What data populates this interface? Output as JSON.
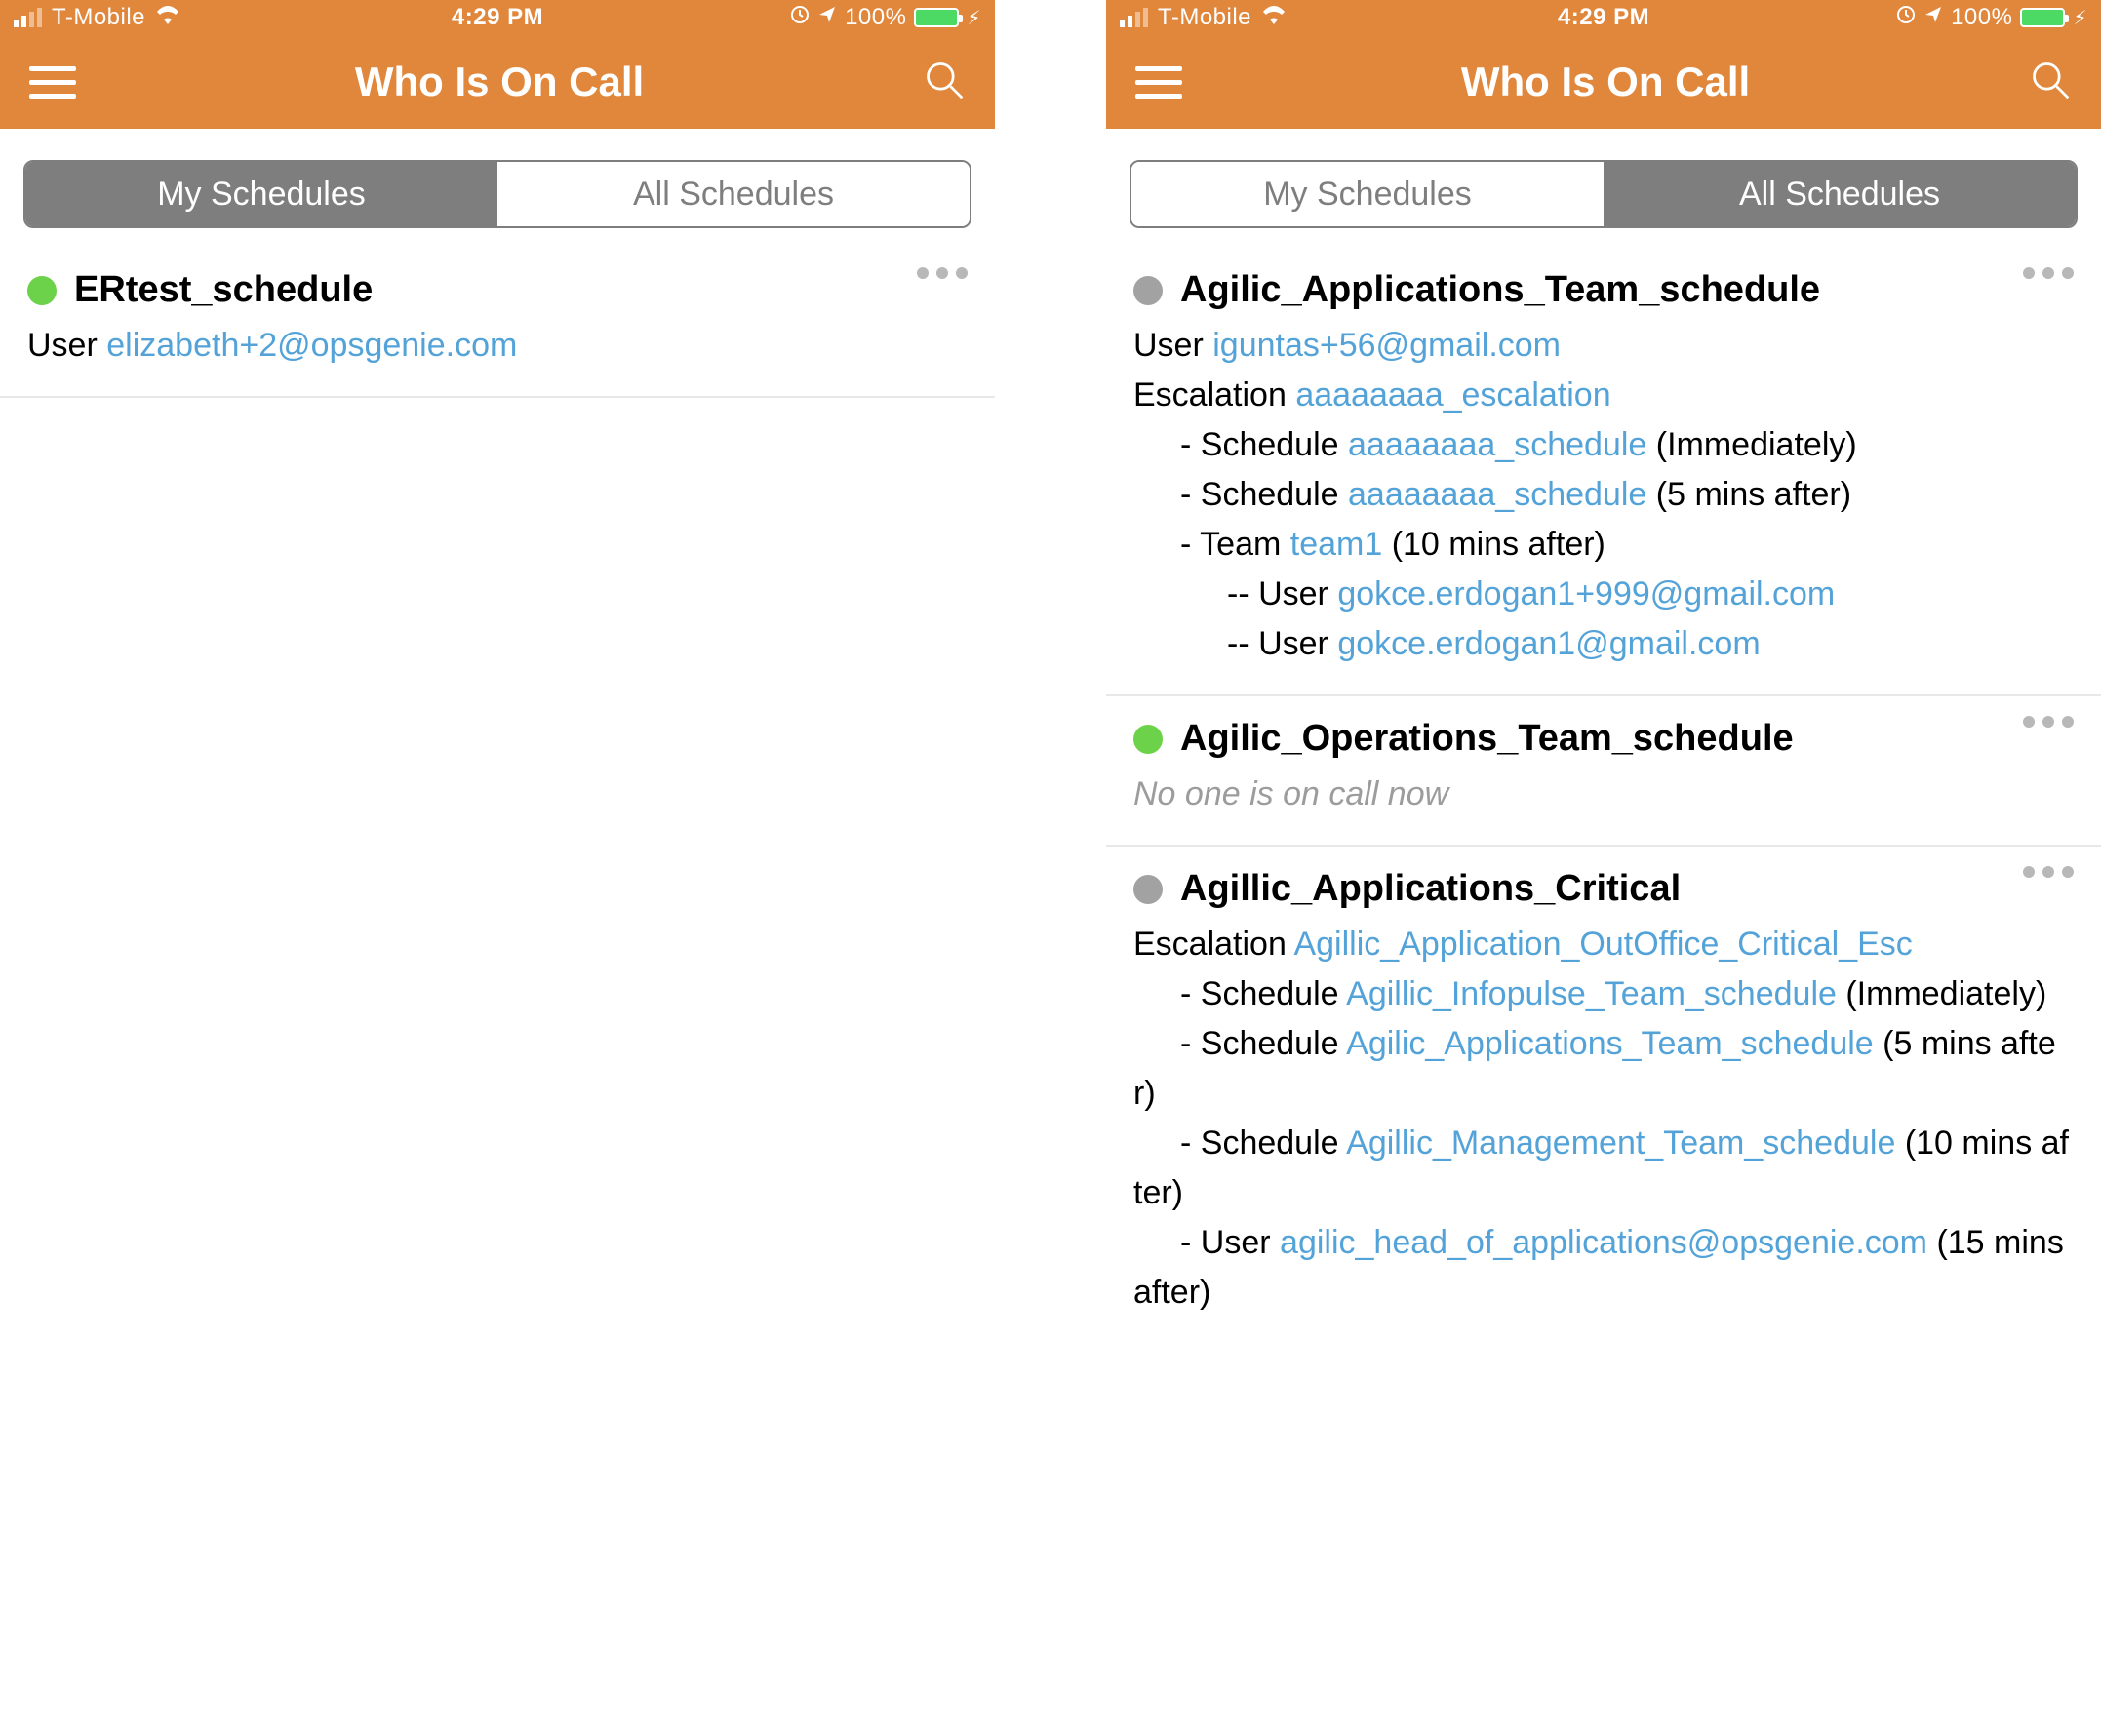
{
  "status_bar": {
    "carrier": "T-Mobile",
    "time": "4:29 PM",
    "battery": "100%"
  },
  "header": {
    "title": "Who Is On Call"
  },
  "tabs": {
    "my": "My Schedules",
    "all": "All Schedules"
  },
  "labels": {
    "user": "User",
    "escalation": "Escalation",
    "schedule": "Schedule",
    "team": "Team",
    "no_one": "No one is on call now"
  },
  "left": {
    "item1": {
      "title": "ERtest_schedule",
      "user": "elizabeth+2@opsgenie.com"
    }
  },
  "right": {
    "item1": {
      "title": "Agilic_Applications_Team_schedule",
      "user": "iguntas+56@gmail.com",
      "escalation": "aaaaaaaa_escalation",
      "step1_schedule": "aaaaaaaa_schedule",
      "step1_delay": "(Immediately)",
      "step2_schedule": "aaaaaaaa_schedule",
      "step2_delay": "(5 mins after)",
      "step3_team": "team1",
      "step3_delay": "(10 mins after)",
      "step3_user1": "gokce.erdogan1+999@gmail.com",
      "step3_user2": "gokce.erdogan1@gmail.com"
    },
    "item2": {
      "title": "Agilic_Operations_Team_schedule"
    },
    "item3": {
      "title": "Agillic_Applications_Critical",
      "escalation": "Agillic_Application_OutOffice_Critical_Esc",
      "step1_schedule": "Agillic_Infopulse_Team_schedule",
      "step1_delay": "(Immediately)",
      "step2_schedule": "Agilic_Applications_Team_schedule",
      "step2_delay": "(5 mins after)",
      "step3_schedule": "Agillic_Management_Team_schedule",
      "step3_delay": "(10 mins after)",
      "step4_user": "agilic_head_of_applications@opsgenie.com",
      "step4_delay": "(15 mins after)"
    }
  }
}
